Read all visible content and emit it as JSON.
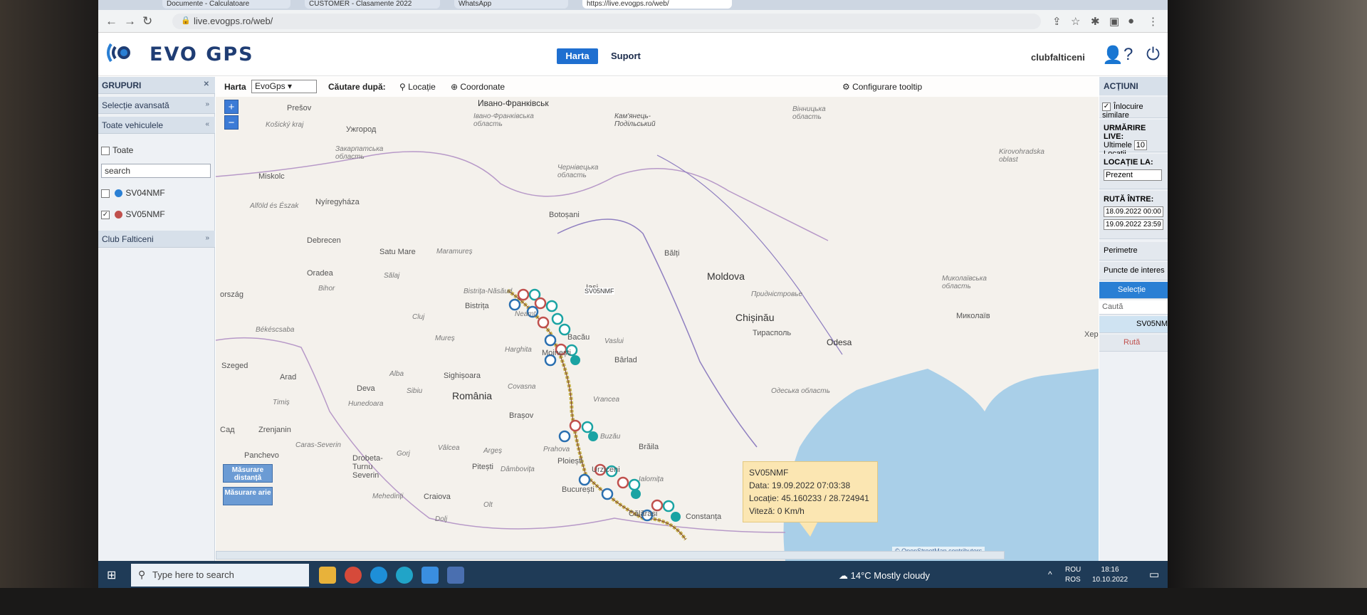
{
  "browser": {
    "url": "live.evogps.ro/web/",
    "tabs": [
      "Documente - Calculatoare",
      "CUSTOMER - Clasamente 2022",
      "WhatsApp",
      "https://live.evogps.ro/web/"
    ]
  },
  "header": {
    "logo_text": "EVO GPS",
    "nav": {
      "harta": "Harta",
      "suport": "Suport"
    },
    "user": "clubfalticeni"
  },
  "left_panel": {
    "title": "GRUPURI",
    "advanced": "Selecție avansată",
    "all_vehicles": "Toate vehiculele",
    "select_all": "Toate",
    "search_value": "search",
    "vehicles": [
      {
        "name": "SV04NMF",
        "checked": false,
        "color": "#2a7fd4"
      },
      {
        "name": "SV05NMF",
        "checked": true,
        "color": "#c0504d"
      }
    ],
    "club": "Club Falticeni"
  },
  "map_toolbar": {
    "harta_label": "Harta",
    "map_type": "EvoGps",
    "search_by": "Căutare după:",
    "locatie": "Locație",
    "coordonate": "Coordonate",
    "configure": "Configurare tooltip"
  },
  "map": {
    "places": [
      "Ивано-Франківськ",
      "Івано-Франківська область",
      "Кам'янець-Подільський",
      "Вінницька область",
      "Чернівецька область",
      "Закарпатська область",
      "Ужгород",
      "Kirovohradska oblast",
      "Prešov",
      "Košický kraj",
      "Miskolc",
      "Nyíregyháza",
      "Debrecen",
      "Satu Mare",
      "Maramureș",
      "Botoșani",
      "Bălți",
      "Moldova",
      "Iași",
      "Bistrița-Năsăud",
      "Bistrița",
      "Neamț",
      "Придністровье",
      "Chișinău",
      "Тирасполь",
      "Миколаївська область",
      "Миколаїв",
      "Oradea",
      "Bihor",
      "Sălaj",
      "Cluj",
      "Mureș",
      "Harghita",
      "Moinești",
      "Bacău",
      "Vaslui",
      "Bârlad",
      "Békéscsaba",
      "Arad",
      "Alba",
      "Sighișoara",
      "Odesa",
      "Одеська область",
      "Deva",
      "Hunedoara",
      "Sibiu",
      "România",
      "Covasna",
      "Vrancea",
      "Brașov",
      "Timiș",
      "Caras-Severin",
      "Buzău",
      "Brăila",
      "Prahova",
      "Ploiești",
      "Drobeta-Turnu Severin",
      "Gorj",
      "Vâlcea",
      "Argeș",
      "Pitești",
      "Dâmbovița",
      "Urziceni",
      "Ialomița",
      "București",
      "Craiova",
      "Olt",
      "Dolj",
      "Mehedinți",
      "Călărași",
      "Constanța",
      "ország",
      "Szeged",
      "Сад",
      "Alföld és Észak",
      "Panchevo",
      "Zrenjanin",
      "Xep"
    ],
    "route_label": "SV05NMF",
    "measure_distance": "Măsurare distanță",
    "measure_area": "Măsurare arie",
    "osm_credit": "© OpenStreetMap contributors",
    "tooltip": {
      "vehicle": "SV05NMF",
      "date": "Data: 19.09.2022 07:03:38",
      "location": "Locație: 45.160233 / 28.724941",
      "speed": "Viteză: 0 Km/h"
    }
  },
  "right_panel": {
    "title": "ACȚIUNI",
    "replace_similar": "Înlocuire similare",
    "live_tracking": "URMĂRIRE LIVE:",
    "last_label": "Ultimele",
    "last_count": "10",
    "locations_label": "Locații",
    "location_at": "LOCAȚIE LA:",
    "location_value": "Prezent",
    "route_between": "RUTĂ ÎNTRE:",
    "route_from": "18.09.2022 00:00",
    "route_to": "19.09.2022 23:59",
    "perimeters": "Perimetre",
    "poi": "Puncte de interes",
    "selection": "Selecție",
    "search_placeholder": "Caută",
    "tree_vehicle": "SV05NMF",
    "tree_route": "Rută"
  },
  "taskbar": {
    "search_placeholder": "Type here to search",
    "weather": "14°C  Mostly cloudy",
    "lang1": "ROU",
    "lang2": "ROS",
    "time": "18:16",
    "date": "10.10.2022"
  }
}
